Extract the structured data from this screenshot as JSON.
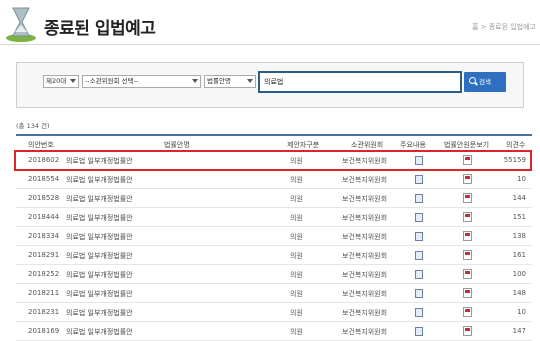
{
  "header": {
    "title": "종료된 입법예고",
    "breadcrumb": "홈 > 종료된 입법예고"
  },
  "search": {
    "age_select": "제20대",
    "committee_select": "--소관위원회 선택--",
    "field_select": "법률안명",
    "keyword": "의료법",
    "search_button": "검색"
  },
  "result_count": "(총 134 건)",
  "table": {
    "headers": [
      "의안번호",
      "법률안명",
      "제안자구분",
      "소관위원회",
      "주요내용",
      "법률안원문보기",
      "의견수"
    ],
    "rows": [
      {
        "no": "2018602",
        "name": "의료법 일부개정법률안",
        "proposer": "의원",
        "committee": "보건복지위원회",
        "opinions": "55159"
      },
      {
        "no": "2018554",
        "name": "의료법 일부개정법률안",
        "proposer": "의원",
        "committee": "보건복지위원회",
        "opinions": "10"
      },
      {
        "no": "2018528",
        "name": "의료법 일부개정법률안",
        "proposer": "의원",
        "committee": "보건복지위원회",
        "opinions": "144"
      },
      {
        "no": "2018444",
        "name": "의료법 일부개정법률안",
        "proposer": "의원",
        "committee": "보건복지위원회",
        "opinions": "151"
      },
      {
        "no": "2018334",
        "name": "의료법 일부개정법률안",
        "proposer": "의원",
        "committee": "보건복지위원회",
        "opinions": "138"
      },
      {
        "no": "2018291",
        "name": "의료법 일부개정법률안",
        "proposer": "의원",
        "committee": "보건복지위원회",
        "opinions": "161"
      },
      {
        "no": "2018252",
        "name": "의료법 일부개정법률안",
        "proposer": "의원",
        "committee": "보건복지위원회",
        "opinions": "100"
      },
      {
        "no": "2018211",
        "name": "의료법 일부개정법률안",
        "proposer": "의원",
        "committee": "보건복지위원회",
        "opinions": "148"
      },
      {
        "no": "2018231",
        "name": "의료법 일부개정법률안",
        "proposer": "의원",
        "committee": "보건복지위원회",
        "opinions": "10"
      },
      {
        "no": "2018169",
        "name": "의료법 일부개정법률안",
        "proposer": "의원",
        "committee": "보건복지위원회",
        "opinions": "147"
      }
    ]
  },
  "icons": {
    "logo": "hourglass-logo-icon",
    "main_content": "document-icon",
    "original_text": "pdf-icon"
  },
  "colors": {
    "accent": "#2f6fbf",
    "highlight": "#d9262c",
    "table_border": "#4a6fa5"
  }
}
